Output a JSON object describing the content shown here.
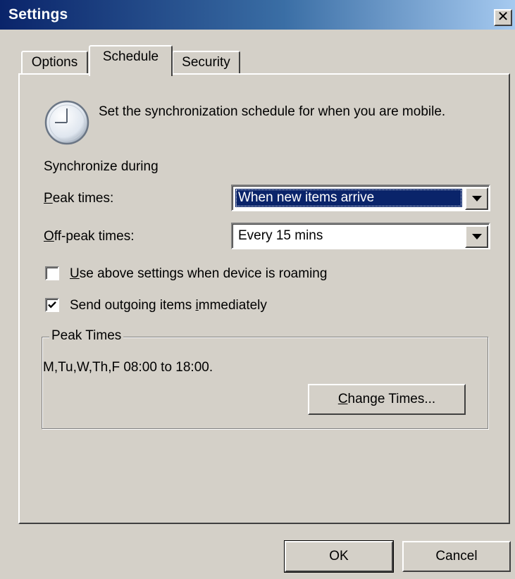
{
  "window": {
    "title": "Settings",
    "close_glyph": "✕"
  },
  "tabs": [
    {
      "label": "Options",
      "active": false
    },
    {
      "label": "Schedule",
      "active": true
    },
    {
      "label": "Security",
      "active": false
    }
  ],
  "schedule": {
    "icon": "clock-icon",
    "intro_text": "Set the synchronization schedule for when you are mobile.",
    "sync_during_label": "Synchronize during",
    "peak_label": {
      "mnemonic": "P",
      "rest": "eak times:"
    },
    "peak_value": "When new items arrive",
    "offpeak_label": {
      "mnemonic": "O",
      "rest": "ff-peak times:"
    },
    "offpeak_value": "Every 15 mins",
    "roaming_checkbox": {
      "mnemonic": "U",
      "rest": "se above settings when device is roaming",
      "checked": false
    },
    "outgoing_checkbox": {
      "before": "Send outgoing items ",
      "mnemonic": "i",
      "after": "mmediately",
      "checked": true
    },
    "peak_group": {
      "title": "Peak Times",
      "summary": "M,Tu,W,Th,F 08:00 to 18:00.",
      "change_button": {
        "mnemonic": "C",
        "rest": "hange Times..."
      }
    }
  },
  "footer": {
    "ok_label": "OK",
    "cancel_label": "Cancel"
  },
  "colors": {
    "dialog_face": "#d4d0c8",
    "titlebar_start": "#0a246a",
    "titlebar_end": "#a6caf0",
    "selection": "#0a246a"
  }
}
